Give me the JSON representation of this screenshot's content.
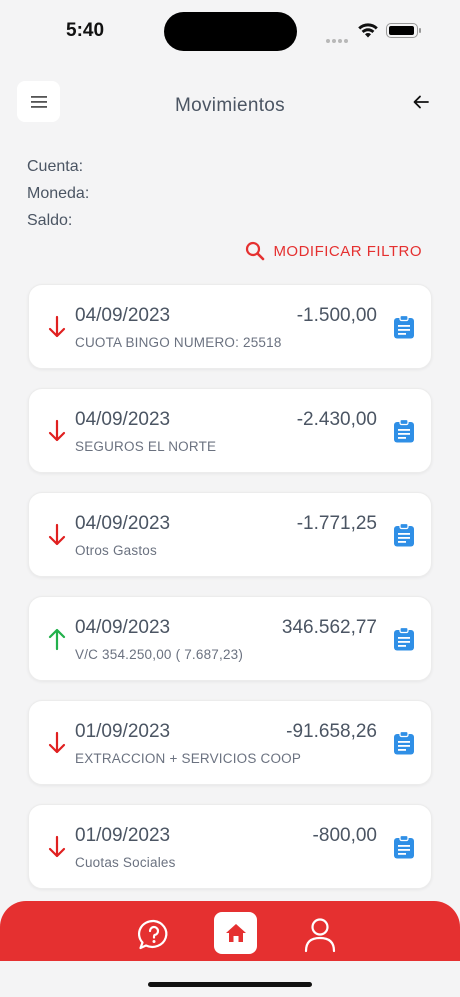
{
  "status_bar": {
    "time": "5:40"
  },
  "header": {
    "title": "Movimientos",
    "menu_icon": "hamburger-icon",
    "back_icon": "arrow-left-icon"
  },
  "account": {
    "cuenta_label": "Cuenta:",
    "moneda_label": "Moneda:",
    "saldo_label": "Saldo:"
  },
  "filter": {
    "label": "MODIFICAR FILTRO",
    "icon": "search-icon"
  },
  "colors": {
    "accent": "#e53030",
    "debit": "#e02020",
    "credit": "#22b14c",
    "detail": "#2f8fe6"
  },
  "movements": [
    {
      "date": "04/09/2023",
      "amount": "-1.500,00",
      "description": "CUOTA BINGO NUMERO: 25518",
      "direction": "down"
    },
    {
      "date": "04/09/2023",
      "amount": "-2.430,00",
      "description": "SEGUROS EL NORTE",
      "direction": "down"
    },
    {
      "date": "04/09/2023",
      "amount": "-1.771,25",
      "description": "Otros Gastos",
      "direction": "down"
    },
    {
      "date": "04/09/2023",
      "amount": "346.562,77",
      "description": "V/C 354.250,00 ( 7.687,23)",
      "direction": "up"
    },
    {
      "date": "01/09/2023",
      "amount": "-91.658,26",
      "description": "EXTRACCION + SERVICIOS COOP",
      "direction": "down"
    },
    {
      "date": "01/09/2023",
      "amount": "-800,00",
      "description": "Cuotas Sociales",
      "direction": "down"
    }
  ],
  "bottom_nav": {
    "help_icon": "help-chat-icon",
    "home_icon": "home-icon",
    "profile_icon": "profile-icon"
  }
}
